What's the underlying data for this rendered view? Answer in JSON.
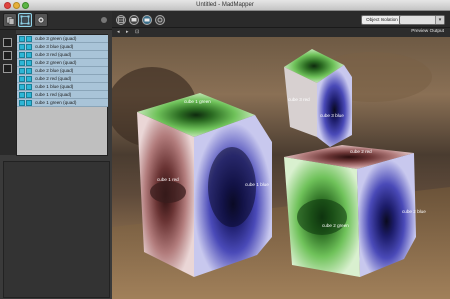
{
  "window": {
    "title": "Untitled - MadMapper"
  },
  "sidebar": {
    "layers": [
      "cube 3 green (quad)",
      "cube 3 blue (quad)",
      "cube 3 red (quad)",
      "cube 2 green (quad)",
      "cube 2 blue (quad)",
      "cube 2 red (quad)",
      "cube 1 blue (quad)",
      "cube 1 red (quad)",
      "cube 1 green (quad)"
    ]
  },
  "toolbar": {
    "object_isolation_label": "Object Isolation",
    "object_select_value": ""
  },
  "viewer": {
    "preview_label": "Preview Output",
    "face_labels": {
      "cube3_blue": "cube 3 blue",
      "cube1_blue": "cube 1 blue",
      "cube1_red": "cube 1 red",
      "cube2_green": "cube 2 green",
      "cube2_red": "cube 2 red",
      "cube2_blue": "cube 2 blue",
      "cube1_green": "cube 1 green",
      "cube3_red": "cube 3 red"
    }
  },
  "colors": {
    "layer_highlight": "#a9c4d8",
    "accent_cyan": "#2db6d6",
    "green_face": "#5aa64a",
    "blue_face": "#3a3aa0",
    "red_face": "#a25858"
  }
}
